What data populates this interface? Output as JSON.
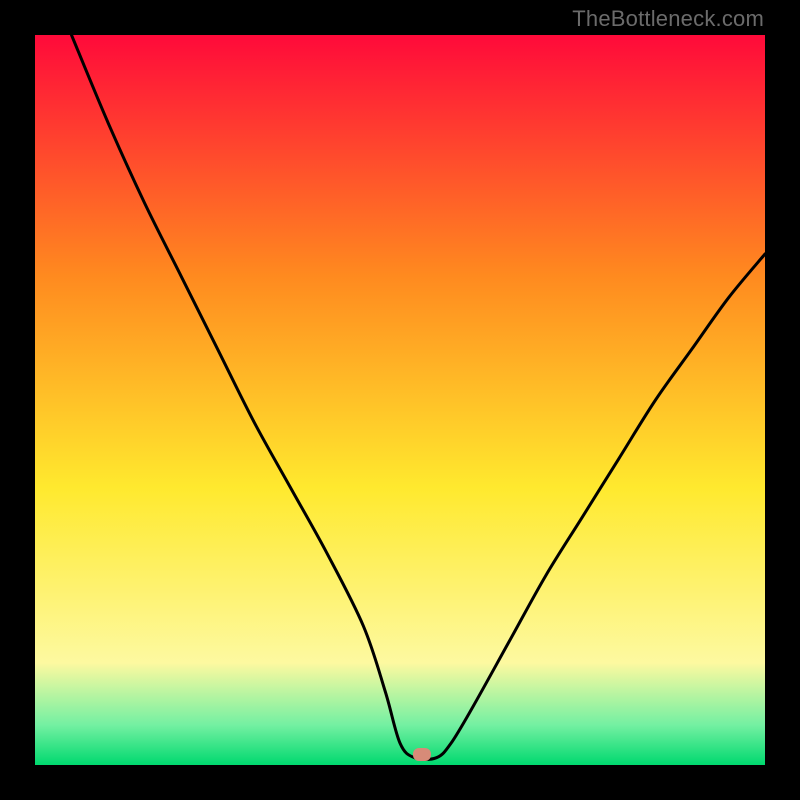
{
  "watermark": "TheBottleneck.com",
  "colors": {
    "red": "#ff0a3a",
    "orange": "#ff8a1f",
    "yellow": "#ffe92e",
    "paleYellow": "#fdf9a0",
    "mint": "#74f0a2",
    "green": "#00d96f",
    "curve": "#000000",
    "marker": "#d78b78",
    "background": "#000000"
  },
  "chart_data": {
    "type": "line",
    "title": "",
    "xlabel": "",
    "ylabel": "",
    "xlim": [
      0,
      100
    ],
    "ylim": [
      0,
      100
    ],
    "legend": false,
    "grid": false,
    "annotations": [
      {
        "name": "marker",
        "x": 53,
        "y": 1.5
      }
    ],
    "series": [
      {
        "name": "bottleneck-curve",
        "x": [
          5,
          10,
          15,
          20,
          25,
          30,
          35,
          40,
          45,
          48,
          50,
          52,
          55,
          57,
          60,
          65,
          70,
          75,
          80,
          85,
          90,
          95,
          100
        ],
        "y": [
          100,
          88,
          77,
          67,
          57,
          47,
          38,
          29,
          19,
          10,
          3,
          1,
          1,
          3,
          8,
          17,
          26,
          34,
          42,
          50,
          57,
          64,
          70
        ]
      }
    ],
    "background_gradient_stops": [
      {
        "pos": 0.0,
        "color": "#ff0a3a"
      },
      {
        "pos": 0.33,
        "color": "#ff8a1f"
      },
      {
        "pos": 0.62,
        "color": "#ffe92e"
      },
      {
        "pos": 0.86,
        "color": "#fdf9a0"
      },
      {
        "pos": 0.945,
        "color": "#74f0a2"
      },
      {
        "pos": 1.0,
        "color": "#00d96f"
      }
    ]
  }
}
